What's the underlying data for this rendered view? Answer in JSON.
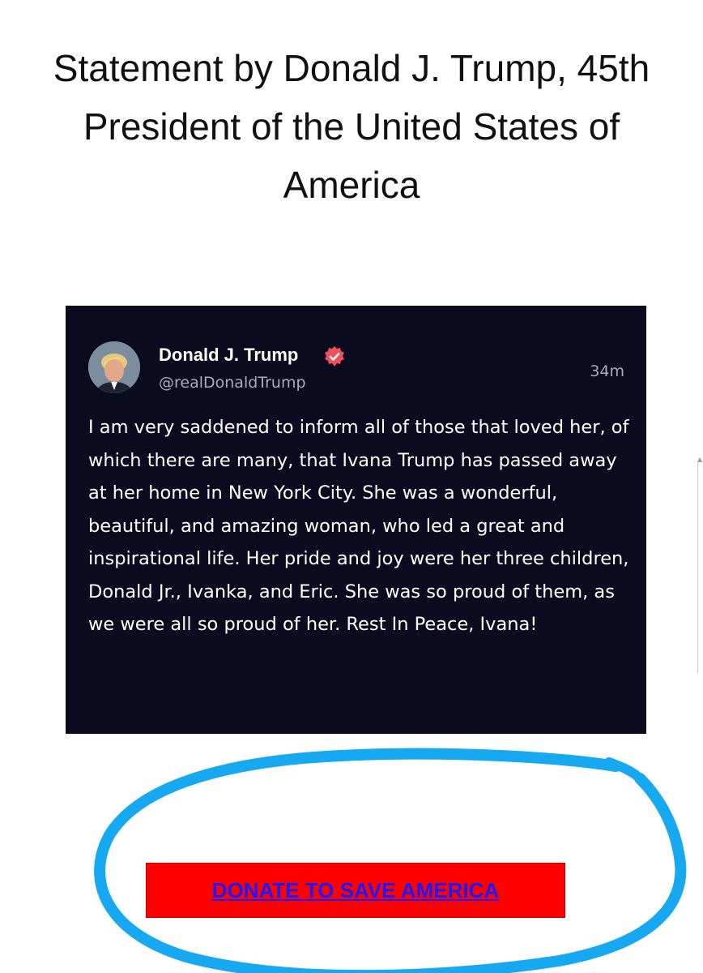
{
  "headline": "Statement by Donald J. Trump, 45th President of the United States of America",
  "post": {
    "author_name": "Donald J. Trump",
    "handle": "@realDonaldTrump",
    "timestamp": "34m",
    "body": "I am very saddened to inform all of those that loved her, of which there are many, that Ivana Trump has passed away at her home in New York City. She was a wonderful, beautiful, and amazing woman, who led a great and inspirational life. Her pride and joy were her three children, Donald Jr., Ivanka, and Eric. She was so proud of them, as we were all so proud of her. Rest In Peace, Ivana!",
    "avatar_icon": "profile-photo",
    "verified_icon": "verified-badge-icon"
  },
  "cta": {
    "label": "DONATE TO SAVE AMERICA"
  },
  "colors": {
    "card_background": "#0b0b1f",
    "verified_badge": "#f04f5a",
    "button_background": "#ff0000",
    "link": "#1a1aff",
    "annotation_circle": "#16a8f0"
  }
}
